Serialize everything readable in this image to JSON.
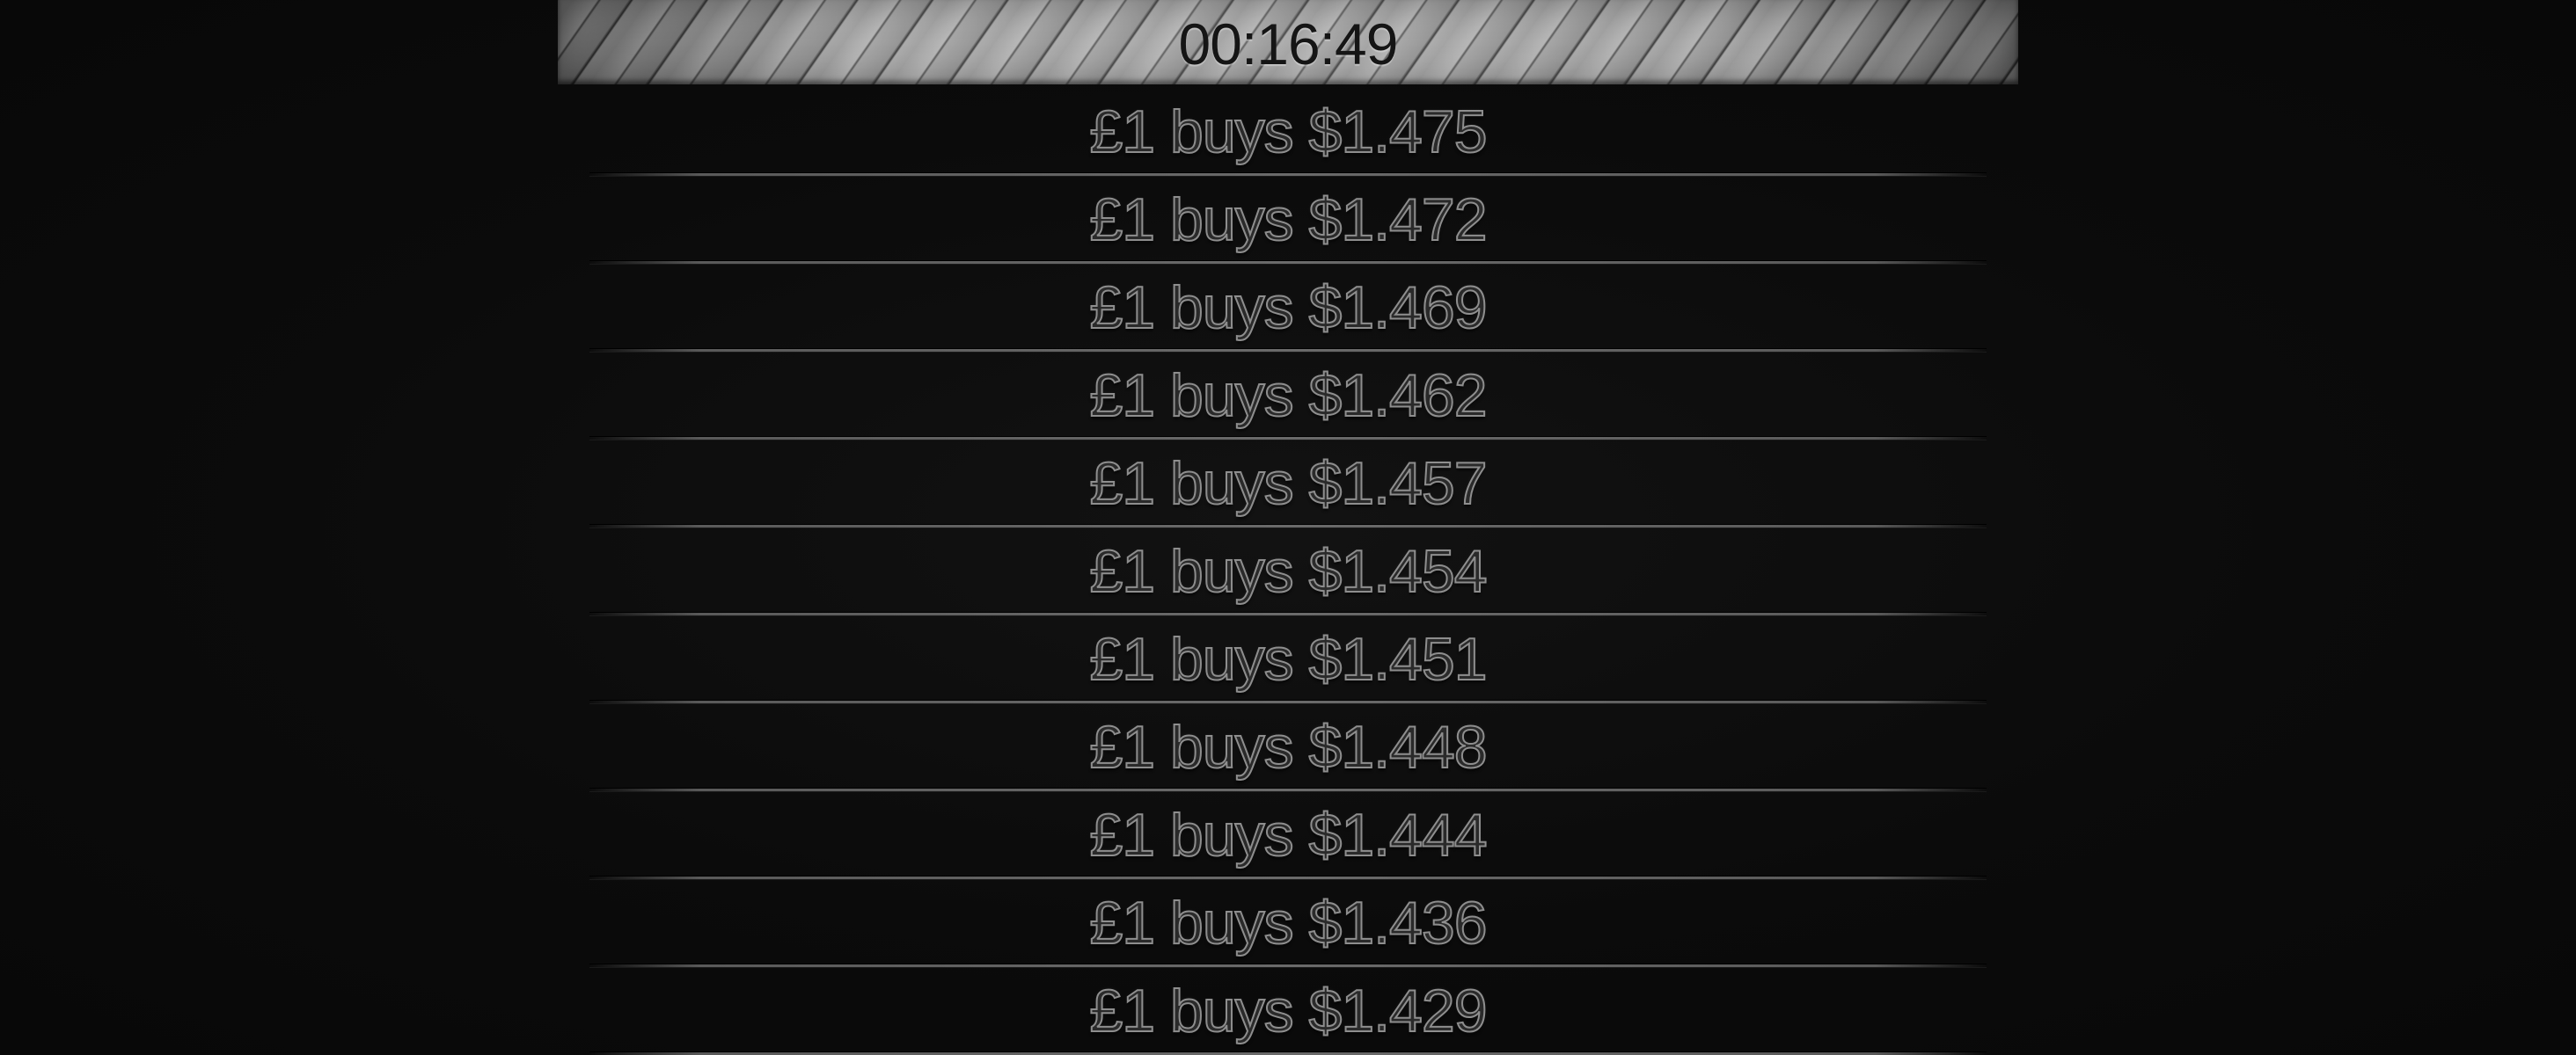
{
  "header": {
    "clock": "00:16:49"
  },
  "rates": [
    {
      "text": "£1 buys $1.475"
    },
    {
      "text": "£1 buys $1.472"
    },
    {
      "text": "£1 buys $1.469"
    },
    {
      "text": "£1 buys $1.462"
    },
    {
      "text": "£1 buys $1.457"
    },
    {
      "text": "£1 buys $1.454"
    },
    {
      "text": "£1 buys $1.451"
    },
    {
      "text": "£1 buys $1.448"
    },
    {
      "text": "£1 buys $1.444"
    },
    {
      "text": "£1 buys $1.436"
    },
    {
      "text": "£1 buys $1.429"
    }
  ],
  "colors": {
    "background": "#0b0b0b",
    "header": "#9a9a9a",
    "clock_text": "#151515",
    "rate_outline": "#8e8e8e"
  }
}
